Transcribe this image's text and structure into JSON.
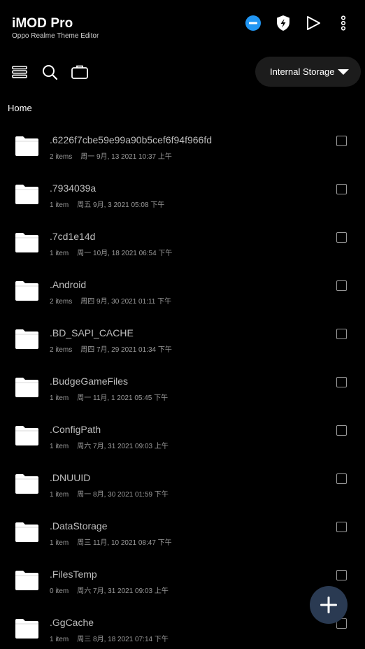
{
  "app": {
    "title": "iMOD Pro",
    "subtitle": "Oppo Realme Theme Editor"
  },
  "top_actions": [
    {
      "icon": "minus-circle-icon",
      "color": "#2196F3"
    },
    {
      "icon": "shield-bolt-icon",
      "color": "#ffffff"
    },
    {
      "icon": "play-icon",
      "color": "#ffffff"
    },
    {
      "icon": "more-vertical-icon",
      "color": "#ffffff"
    }
  ],
  "toolbar": {
    "icons": [
      "stack-layers-icon",
      "search-icon",
      "briefcase-icon"
    ],
    "storage": {
      "selected": "Internal Storage"
    }
  },
  "breadcrumb": {
    "current": "Home"
  },
  "files": [
    {
      "name": ".6226f7cbe59e99a90b5cef6f94f966fd",
      "count": "2 items",
      "date": "周一 9月, 13 2021 10:37 上午"
    },
    {
      "name": ".7934039a",
      "count": "1 item",
      "date": "周五 9月, 3 2021 05:08 下午"
    },
    {
      "name": ".7cd1e14d",
      "count": "1 item",
      "date": "周一 10月, 18 2021 06:54 下午"
    },
    {
      "name": ".Android",
      "count": "2 items",
      "date": "周四 9月, 30 2021 01:11 下午"
    },
    {
      "name": ".BD_SAPI_CACHE",
      "count": "2 items",
      "date": "周四 7月, 29 2021 01:34 下午"
    },
    {
      "name": ".BudgeGameFiles",
      "count": "1 item",
      "date": "周一 11月, 1 2021 05:45 下午"
    },
    {
      "name": ".ConfigPath",
      "count": "1 item",
      "date": "周六 7月, 31 2021 09:03 上午"
    },
    {
      "name": ".DNUUID",
      "count": "1 item",
      "date": "周一 8月, 30 2021 01:59 下午"
    },
    {
      "name": ".DataStorage",
      "count": "1 item",
      "date": "周三 11月, 10 2021 08:47 下午"
    },
    {
      "name": ".FilesTemp",
      "count": "0 item",
      "date": "周六 7月, 31 2021 09:03 上午"
    },
    {
      "name": ".GgCache",
      "count": "1 item",
      "date": "周三 8月, 18 2021 07:14 下午"
    }
  ],
  "fab": {
    "icon": "plus-icon",
    "color": "#2a3a52"
  }
}
